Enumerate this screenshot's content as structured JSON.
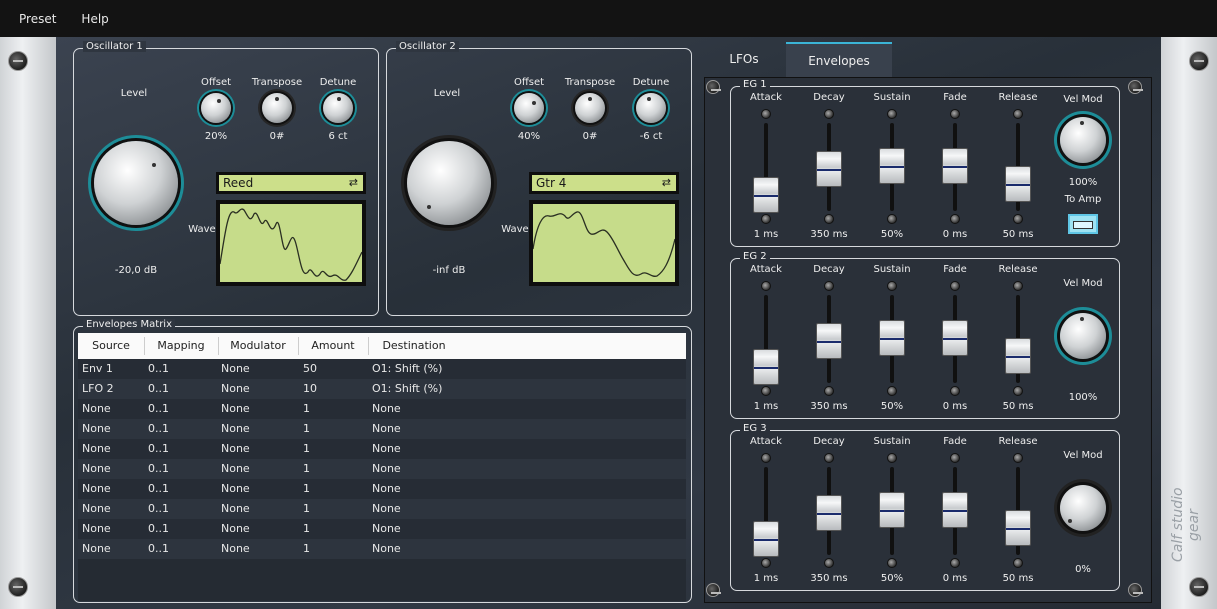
{
  "menu": [
    "Preset",
    "Help"
  ],
  "osc1": {
    "title": "Oscillator 1",
    "level_label": "Level",
    "level_value": "-20,0 dB",
    "offset_label": "Offset",
    "offset_value": "20%",
    "transpose_label": "Transpose",
    "transpose_value": "0#",
    "detune_label": "Detune",
    "detune_value": "6 ct",
    "wave_label": "Wave",
    "wave_name": "Reed"
  },
  "osc2": {
    "title": "Oscillator 2",
    "level_label": "Level",
    "level_value": "-inf dB",
    "offset_label": "Offset",
    "offset_value": "40%",
    "transpose_label": "Transpose",
    "transpose_value": "0#",
    "detune_label": "Detune",
    "detune_value": "-6 ct",
    "wave_label": "Wave",
    "wave_name": "Gtr 4"
  },
  "tabs": [
    "LFOs",
    "Envelopes"
  ],
  "active_tab": "Envelopes",
  "eg_labels": {
    "attack": "Attack",
    "decay": "Decay",
    "sustain": "Sustain",
    "fade": "Fade",
    "release": "Release",
    "velmod": "Vel Mod"
  },
  "eg": [
    {
      "title": "EG 1",
      "attack": "1 ms",
      "decay": "350 ms",
      "sustain": "50%",
      "fade": "0 ms",
      "release": "50 ms",
      "velmod": "100%",
      "to_amp_label": "To Amp",
      "levels": [
        0.1,
        0.55,
        0.6,
        0.6,
        0.3
      ]
    },
    {
      "title": "EG 2",
      "attack": "1 ms",
      "decay": "350 ms",
      "sustain": "50%",
      "fade": "0 ms",
      "release": "50 ms",
      "velmod": "100%",
      "levels": [
        0.1,
        0.55,
        0.6,
        0.6,
        0.3
      ]
    },
    {
      "title": "EG 3",
      "attack": "1 ms",
      "decay": "350 ms",
      "sustain": "50%",
      "fade": "0 ms",
      "release": "50 ms",
      "velmod": "0%",
      "levels": [
        0.1,
        0.55,
        0.6,
        0.6,
        0.3
      ]
    }
  ],
  "matrix": {
    "title": "Envelopes Matrix",
    "headers": [
      "Source",
      "Mapping",
      "Modulator",
      "Amount",
      "Destination"
    ],
    "rows": [
      [
        "Env 1",
        "0..1",
        "None",
        "50",
        "O1: Shift (%)"
      ],
      [
        "LFO 2",
        "0..1",
        "None",
        "10",
        "O1: Shift (%)"
      ],
      [
        "None",
        "0..1",
        "None",
        "1",
        "None"
      ],
      [
        "None",
        "0..1",
        "None",
        "1",
        "None"
      ],
      [
        "None",
        "0..1",
        "None",
        "1",
        "None"
      ],
      [
        "None",
        "0..1",
        "None",
        "1",
        "None"
      ],
      [
        "None",
        "0..1",
        "None",
        "1",
        "None"
      ],
      [
        "None",
        "0..1",
        "None",
        "1",
        "None"
      ],
      [
        "None",
        "0..1",
        "None",
        "1",
        "None"
      ],
      [
        "None",
        "0..1",
        "None",
        "1",
        "None"
      ]
    ]
  },
  "colors": {
    "accent": "#1d8d98",
    "lcd": "#c6dc8a",
    "tab_highlight": "#3bb4d6"
  },
  "logo": "Calf studio gear"
}
